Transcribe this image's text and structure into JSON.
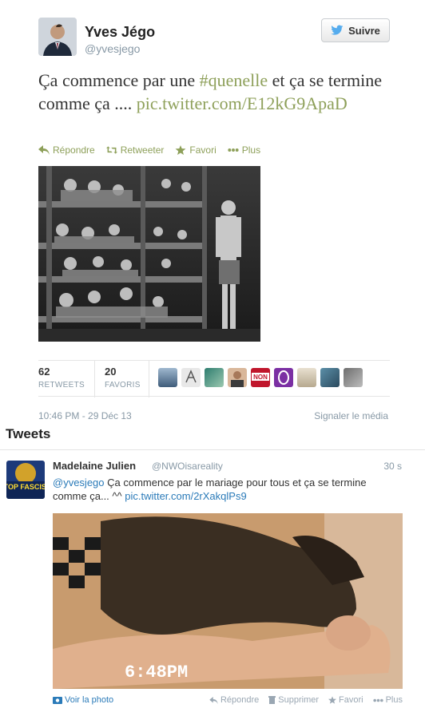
{
  "tweet": {
    "author_name": "Yves Jégo",
    "author_handle": "@yvesjego",
    "follow_label": "Suivre",
    "text_start": "Ça commence par une ",
    "hashtag": "#quenelle",
    "text_end": " et ça se termine comme ça .... ",
    "link": "pic.twitter.com/E12kG9ApaD",
    "actions": {
      "reply": "Répondre",
      "retweet": "Retweeter",
      "favorite": "Favori",
      "more": "Plus"
    },
    "stats": {
      "retweets_count": "62",
      "retweets_label": "RETWEETS",
      "favorites_count": "20",
      "favorites_label": "FAVORIS"
    },
    "datetime": "10:46 PM - 29 Déc 13",
    "report_label": "Signaler le média"
  },
  "section_title": "Tweets",
  "reply_tweet": {
    "author_name": "Madelaine Julien",
    "author_handle": "@NWOisareality",
    "time": "30 s",
    "mention": "@yvesjego",
    "text": " Ça commence par le mariage pour tous et ça se termine comme ça... ^^ ",
    "link": "pic.twitter.com/2rXakqlPs9",
    "avatar_text": "STOP FASCISM",
    "photo_caption": "6:48PM",
    "view_photo": "Voir la photo",
    "actions": {
      "reply": "Répondre",
      "delete": "Supprimer",
      "favorite": "Favori",
      "more": "Plus"
    }
  },
  "colors": {
    "link_green": "#8ea05a",
    "link_blue": "#2b7bb9",
    "muted": "#8899a6",
    "twitter_bird": "#55acee"
  }
}
